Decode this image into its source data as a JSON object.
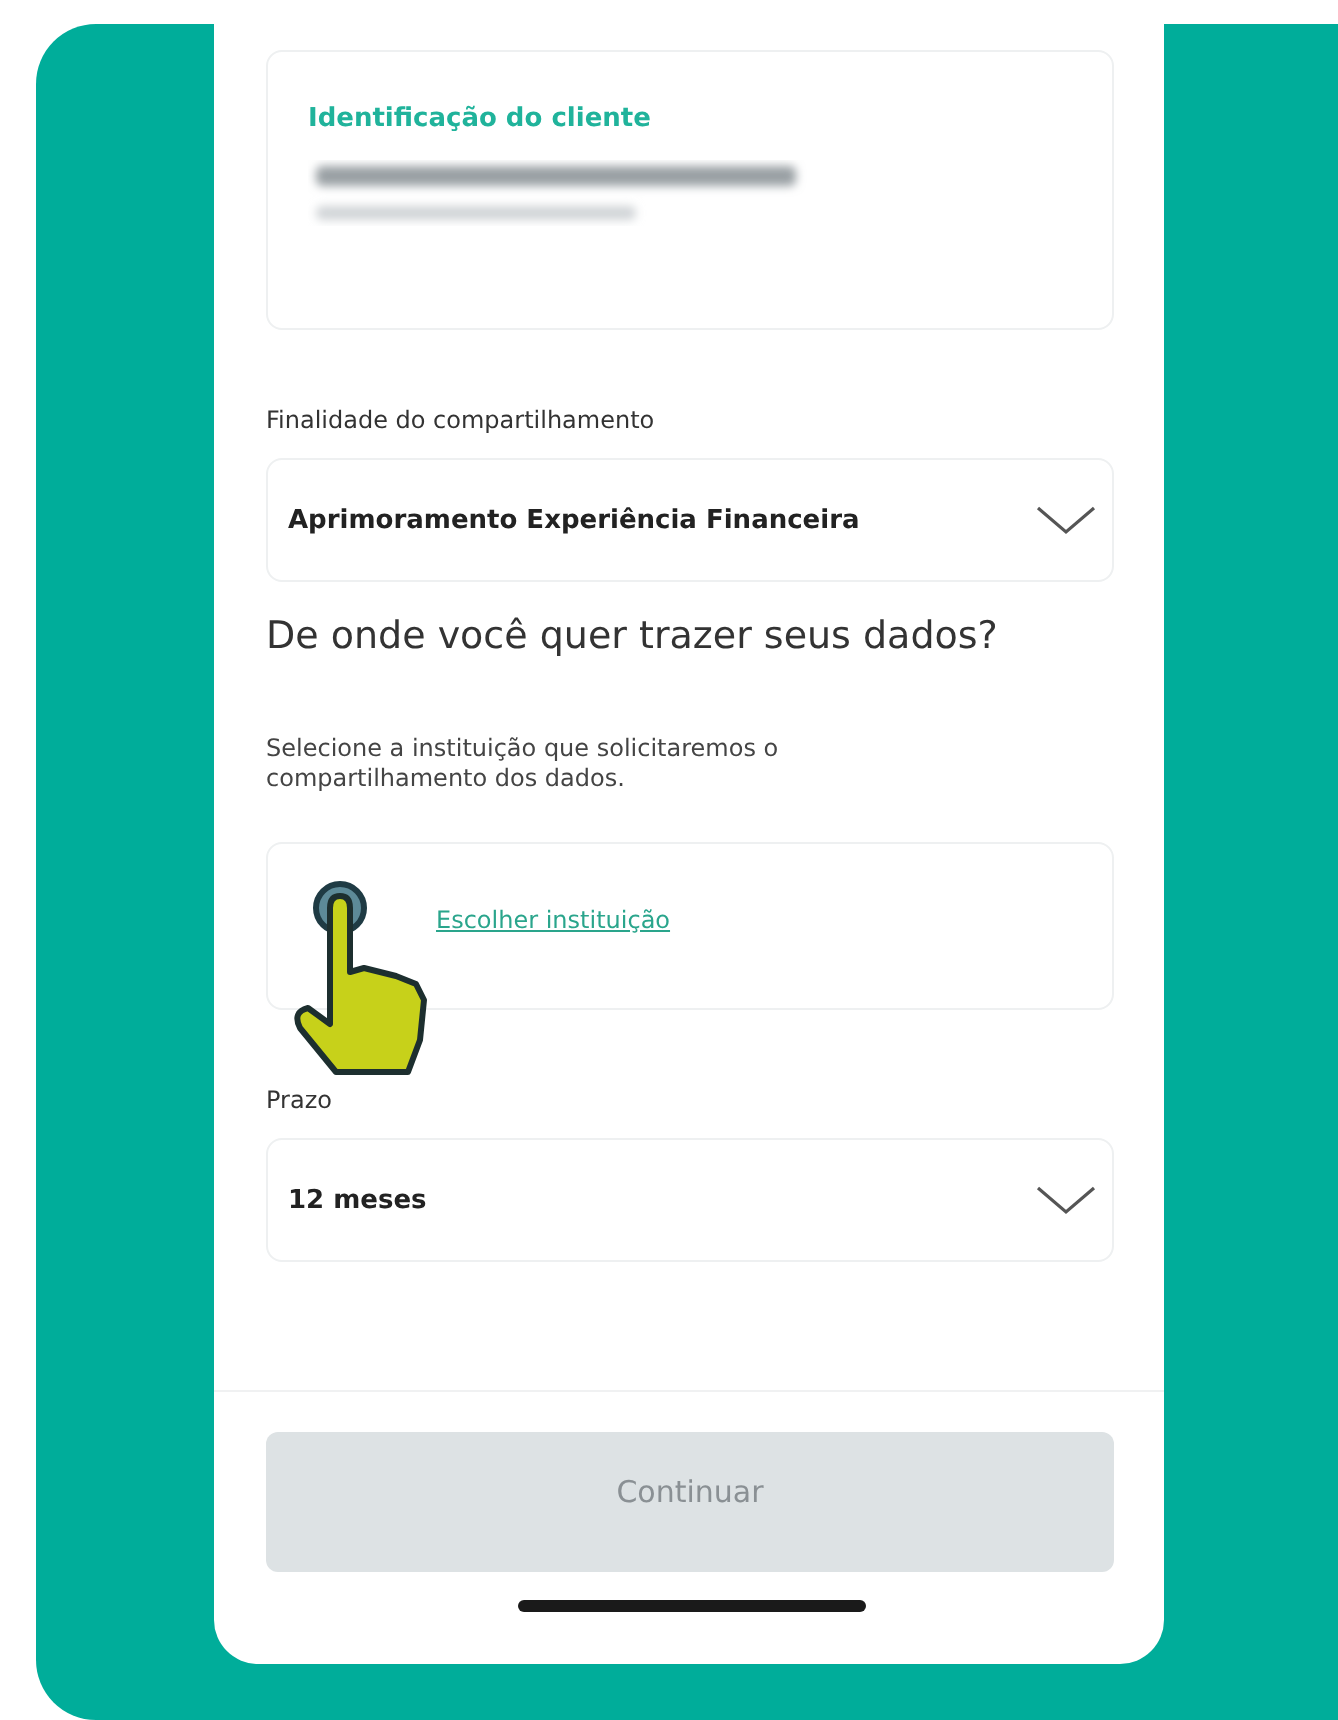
{
  "client_card": {
    "title": "Identificação do cliente"
  },
  "purpose": {
    "label": "Finalidade do compartilhamento",
    "value": "Aprimoramento Experiência Financeira"
  },
  "heading": "De onde você quer trazer seus dados?",
  "description": "Selecione a instituição que solicitaremos o compartilhamento dos dados.",
  "institution": {
    "link": "Escolher instituição"
  },
  "term": {
    "label": "Prazo",
    "value": "12 meses"
  },
  "continue_button": {
    "label": "Continuar",
    "disabled": true
  }
}
